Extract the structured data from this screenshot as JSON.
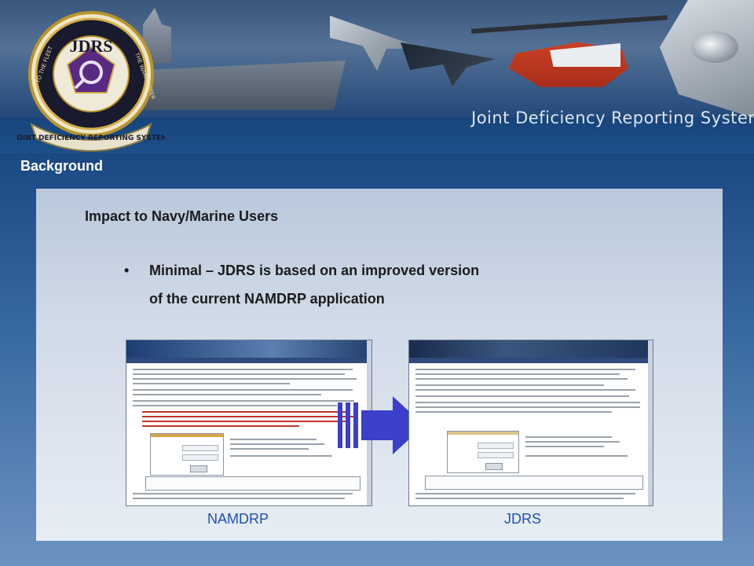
{
  "banner": {
    "title": "Joint Deficiency Reporting System",
    "seal": {
      "center_text": "JDRS",
      "ring_left": "TO THE FLEET",
      "ring_right": "THE WARFIGHTER",
      "scroll_text": "JOINT DEFICIENCY REPORTING SYSTEM"
    }
  },
  "section_label": "Background",
  "heading": "Impact to Navy/Marine Users",
  "bullet": {
    "marker": "•",
    "line1": "Minimal – JDRS is based on an improved version",
    "line2": "of the current NAMDRP application"
  },
  "screenshots": {
    "left_caption": "NAMDRP",
    "right_caption": "JDRS"
  },
  "colors": {
    "banner_dark": "#0a2247",
    "panel": "#cfd9e7",
    "caption": "#1f4fb8",
    "arrow": "#3b3fc9"
  }
}
